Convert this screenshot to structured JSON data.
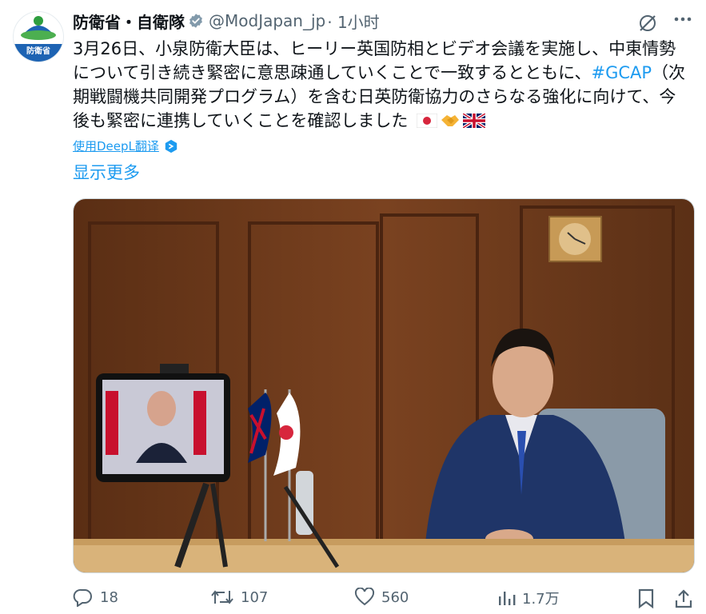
{
  "author": {
    "display_name": "防衛省・自衛隊",
    "handle": "@ModJapan_jp",
    "time": "· 1小时",
    "avatar_label": "防衛省"
  },
  "tweet": {
    "text_before_tag": "3月26日、小泉防衛大臣は、ヒーリー英国防相とビデオ会議を実施し、中東情勢について引き続き緊密に意思疎通していくことで一致するとともに、",
    "hashtag": "#GCAP",
    "text_after_tag": "（次期戦闘機共同開発プログラム）を含む日英防衛協力のさらなる強化に向けて、今後も緊密に連携していくことを確認しました",
    "emojis": [
      "flag-japan",
      "handshake",
      "flag-uk"
    ]
  },
  "translate_label": "使用DeepL翻译",
  "show_more_label": "显示更多",
  "actions": {
    "reply_count": "18",
    "retweet_count": "107",
    "like_count": "560",
    "views_count": "1.7万"
  },
  "colors": {
    "accent": "#1d9bf0",
    "secondary_text": "#536471",
    "primary_text": "#0f1419",
    "verified_badge": "#829aab"
  }
}
